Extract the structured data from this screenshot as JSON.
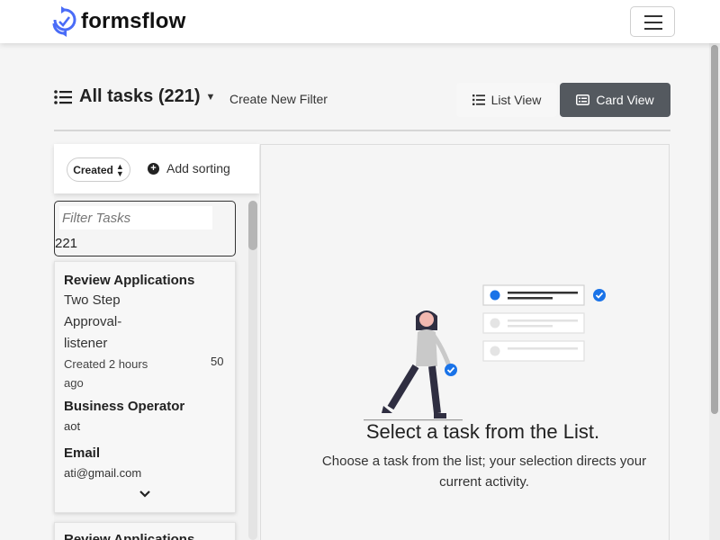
{
  "brand": {
    "name": "formsflow",
    "logo_icon": "formsflow-logo-icon"
  },
  "navbar": {
    "toggle_icon": "hamburger-menu-icon"
  },
  "header": {
    "title": "All tasks (221)",
    "create_filter_label": "Create New Filter",
    "list_view_label": "List View",
    "card_view_label": "Card View",
    "active_view": "Card View"
  },
  "sorting": {
    "chip_label": "Created",
    "add_sorting_label": "Add sorting"
  },
  "filter": {
    "placeholder": "Filter Tasks",
    "count": "221"
  },
  "tasks": [
    {
      "name": "Review Applications",
      "process_lines": [
        "Two Step",
        "Approval-",
        "listener"
      ],
      "created_lines": [
        "Created 2 hours",
        "ago"
      ],
      "priority": "50",
      "fields": [
        {
          "label": "Business Operator",
          "value": "aot"
        },
        {
          "label": "Email",
          "value": "ati@gmail.com"
        }
      ]
    },
    {
      "name": "Review Applications"
    }
  ],
  "empty_state": {
    "title": "Select a task from the List.",
    "subtitle": "Choose a task from the list; your selection directs your current activity."
  },
  "colors": {
    "brand_blue": "#4a6cf7",
    "check_blue": "#1a73e8",
    "card_view_bg": "#54595f",
    "topbar_bg": "#ffffff"
  }
}
